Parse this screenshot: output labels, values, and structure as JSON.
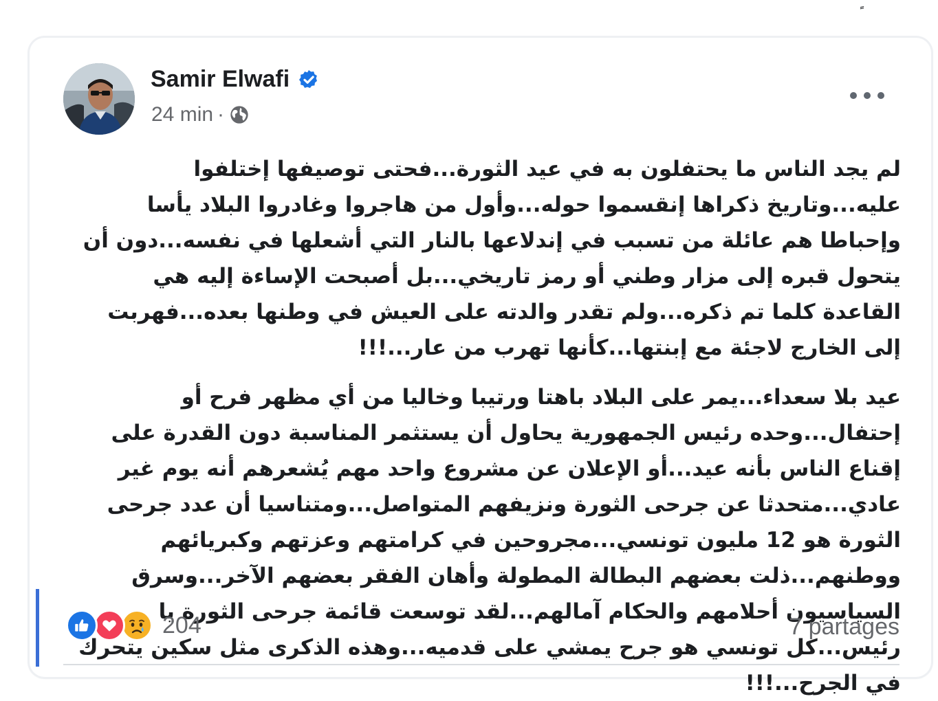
{
  "post": {
    "author": "Samir Elwafi",
    "verified": true,
    "time": "24 min",
    "separator": "·",
    "audience_icon": "globe-icon",
    "paragraphs": [
      "لم يجد الناس ما يحتفلون به في عيد الثورة...فحتى توصيفها إختلفوا عليه...وتاريخ ذكراها إنقسموا حوله...وأول من هاجروا وغادروا البلاد يأسا وإحباطا هم عائلة من تسبب في إندلاعها بالنار التي أشعلها في نفسه...دون أن يتحول قبره إلى مزار وطني أو رمز تاريخي...بل أصبحت الإساءة إليه هي القاعدة كلما تم ذكره...ولم تقدر والدته على العيش في وطنها بعده...فهربت إلى الخارج لاجئة مع إبنتها...كأنها تهرب من عار...!!!",
      "عيد بلا سعداء...يمر على البلاد باهتا ورتيبا وخاليا من أي مظهر فرح أو إحتفال...وحده رئيس الجمهورية يحاول أن يستثمر المناسبة دون القدرة على إقناع الناس بأنه عيد...أو الإعلان عن مشروع واحد مهم يُشعرهم أنه يوم غير عادي...متحدثا عن جرحى الثورة ونزيفهم المتواصل...ومتناسيا أن عدد جرحى الثورة هو 12 مليون تونسي...مجروحين في كرامتهم وعزتهم وكبريائهم ووطنهم...ذلت بعضهم البطالة المطولة وأهان الفقر بعضهم الآخر...وسرق السياسيون أحلامهم والحكام آمالهم...لقد توسعت قائمة جرحى الثورة يا رئيس...كل تونسي هو جرح يمشي على قدميه...وهذه الذكرى مثل سكين يتحرك في الجرح...!!!"
    ],
    "reactions": {
      "types": [
        "like-icon",
        "love-icon",
        "sad-icon"
      ],
      "count": "204"
    },
    "shares": "7 partages"
  },
  "colors": {
    "accent": "#1b74e4",
    "text": "#1c1e21",
    "muted": "#65676b",
    "love": "#f33e58",
    "sad": "#f7b125"
  }
}
